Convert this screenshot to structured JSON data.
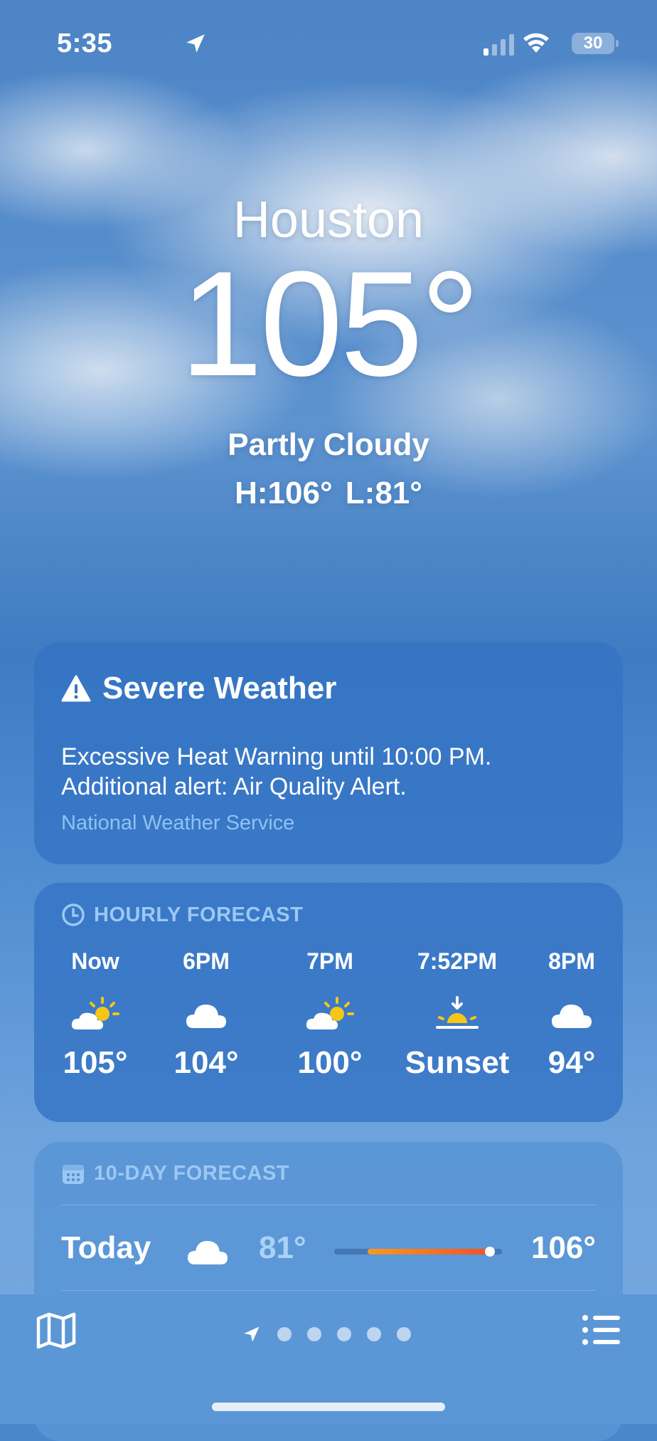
{
  "status_bar": {
    "time": "5:35",
    "battery": "30"
  },
  "hero": {
    "city": "Houston",
    "temperature": "105°",
    "condition": "Partly Cloudy",
    "high_low": "H:106° L:81°"
  },
  "alert": {
    "title": "Severe Weather",
    "body": "Excessive Heat Warning until 10:00 PM. Additional alert: Air Quality Alert.",
    "source": "National Weather Service"
  },
  "hourly": {
    "header": "HOURLY FORECAST",
    "items": [
      {
        "time": "Now",
        "icon": "partly-cloudy-icon",
        "value": "105°"
      },
      {
        "time": "6PM",
        "icon": "cloud-icon",
        "value": "104°"
      },
      {
        "time": "7PM",
        "icon": "partly-cloudy-icon",
        "value": "100°"
      },
      {
        "time": "7:52PM",
        "icon": "sunset-icon",
        "value": "Sunset"
      },
      {
        "time": "8PM",
        "icon": "cloud-icon",
        "value": "94°"
      }
    ]
  },
  "ten_day": {
    "header": "10-DAY FORECAST",
    "rows": [
      {
        "day": "Today",
        "icon": "cloud-icon",
        "low": "81°",
        "high": "106°",
        "range_start": 0.2,
        "range_end": 0.95,
        "current": 0.93
      }
    ]
  },
  "tabbar": {
    "page_count": 5,
    "active_page": "current-location"
  },
  "colors": {
    "accent_low": "#a9d2f6",
    "bar_warm": "#f29a22",
    "bar_hot": "#f0502a",
    "source_link": "#8fc1f2"
  }
}
